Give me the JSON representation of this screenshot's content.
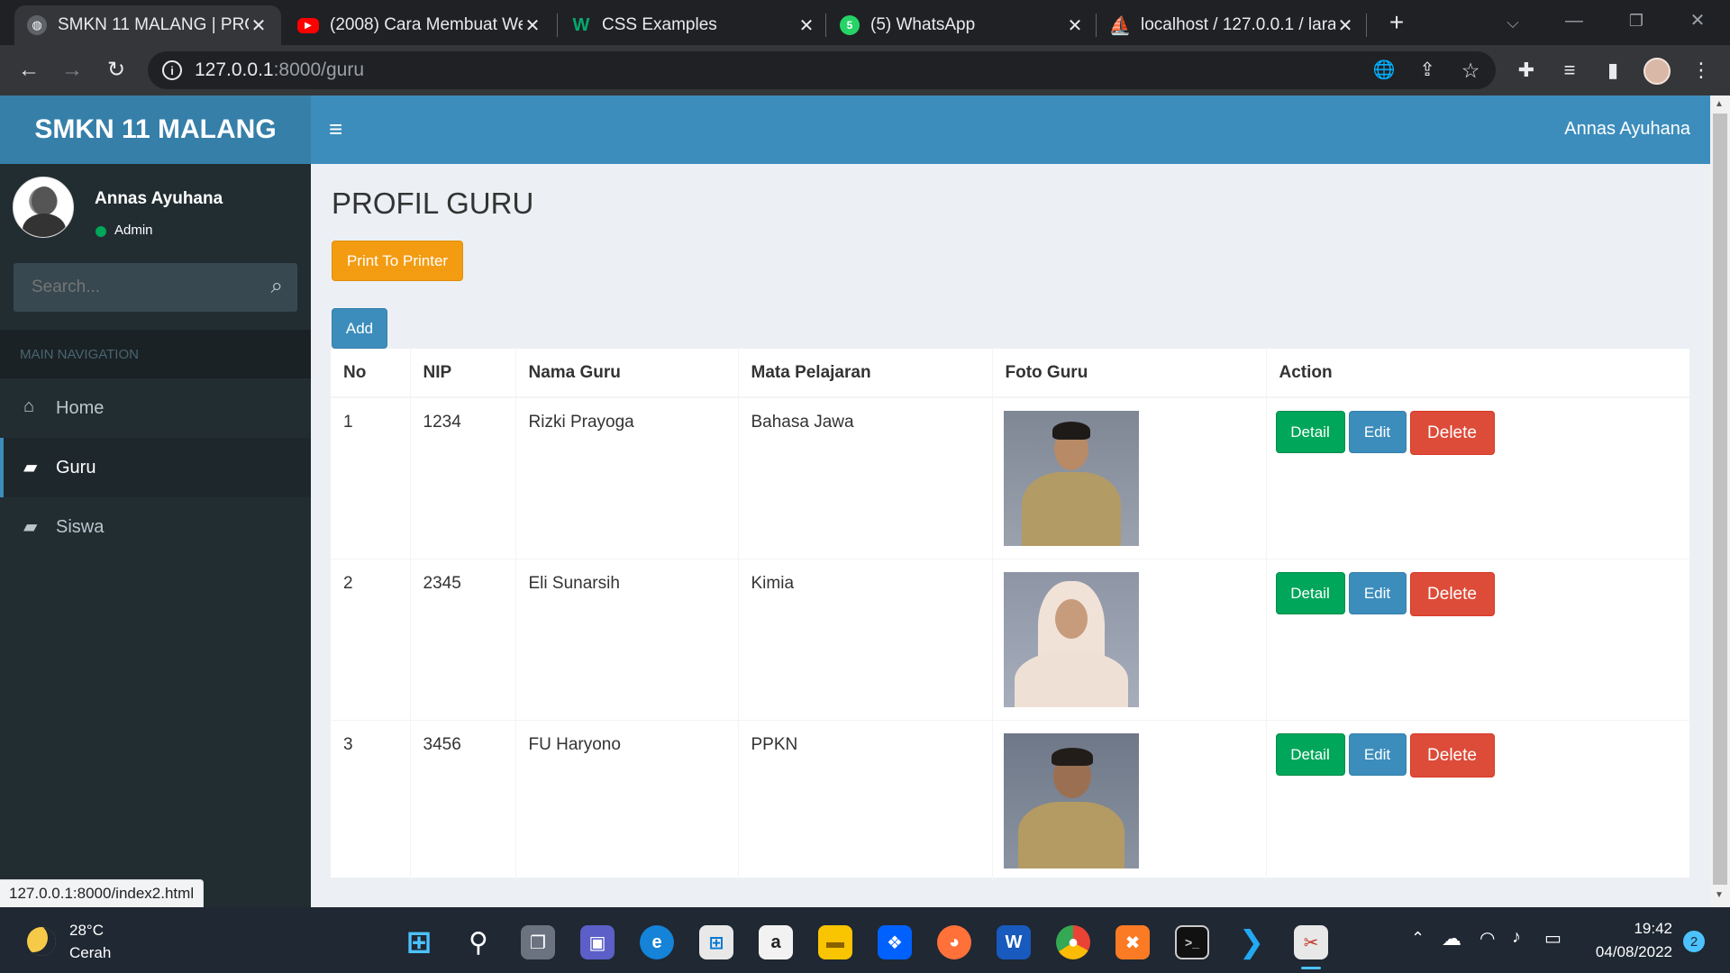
{
  "browser": {
    "tabs": [
      {
        "title": "SMKN 11 MALANG | PROI",
        "icon": "globe-icon",
        "active": true
      },
      {
        "title": "(2008) Cara Membuat We",
        "icon": "youtube-icon"
      },
      {
        "title": "CSS Examples",
        "icon": "w3schools-icon"
      },
      {
        "title": "(5) WhatsApp",
        "icon": "whatsapp-icon",
        "badge": "5"
      },
      {
        "title": "localhost / 127.0.0.1 / lara",
        "icon": "phpmyadmin-icon"
      }
    ],
    "url_host": "127.0.0.1",
    "url_path": ":8000/guru",
    "status_url": "127.0.0.1:8000/index2.html"
  },
  "app": {
    "brand": "SMKN 11 MALANG",
    "user_name": "Annas Ayuhana",
    "user_role": "Admin",
    "search_placeholder": "Search...",
    "nav_header": "MAIN NAVIGATION",
    "nav_items": [
      {
        "label": "Home",
        "icon": "home-icon"
      },
      {
        "label": "Guru",
        "icon": "book-icon",
        "active": true
      },
      {
        "label": "Siswa",
        "icon": "book-icon"
      }
    ]
  },
  "page": {
    "title": "PROFIL GURU",
    "print_button": "Print To Printer",
    "add_button": "Add",
    "columns": [
      "No",
      "NIP",
      "Nama Guru",
      "Mata Pelajaran",
      "Foto Guru",
      "Action"
    ],
    "rows": [
      {
        "no": "1",
        "nip": "1234",
        "nama": "Rizki Prayoga",
        "mapel": "Bahasa Jawa"
      },
      {
        "no": "2",
        "nip": "2345",
        "nama": "Eli Sunarsih",
        "mapel": "Kimia"
      },
      {
        "no": "3",
        "nip": "3456",
        "nama": "FU Haryono",
        "mapel": "PPKN"
      }
    ],
    "actions": {
      "detail": "Detail",
      "edit": "Edit",
      "delete": "Delete"
    }
  },
  "taskbar": {
    "temperature": "28°C",
    "weather": "Cerah",
    "time": "19:42",
    "date": "04/08/2022",
    "notifications": "2"
  },
  "colors": {
    "primary": "#3c8dbc",
    "warning": "#f39c12",
    "success": "#00a65a",
    "danger": "#dd4b39",
    "sidebar": "#222d32"
  }
}
